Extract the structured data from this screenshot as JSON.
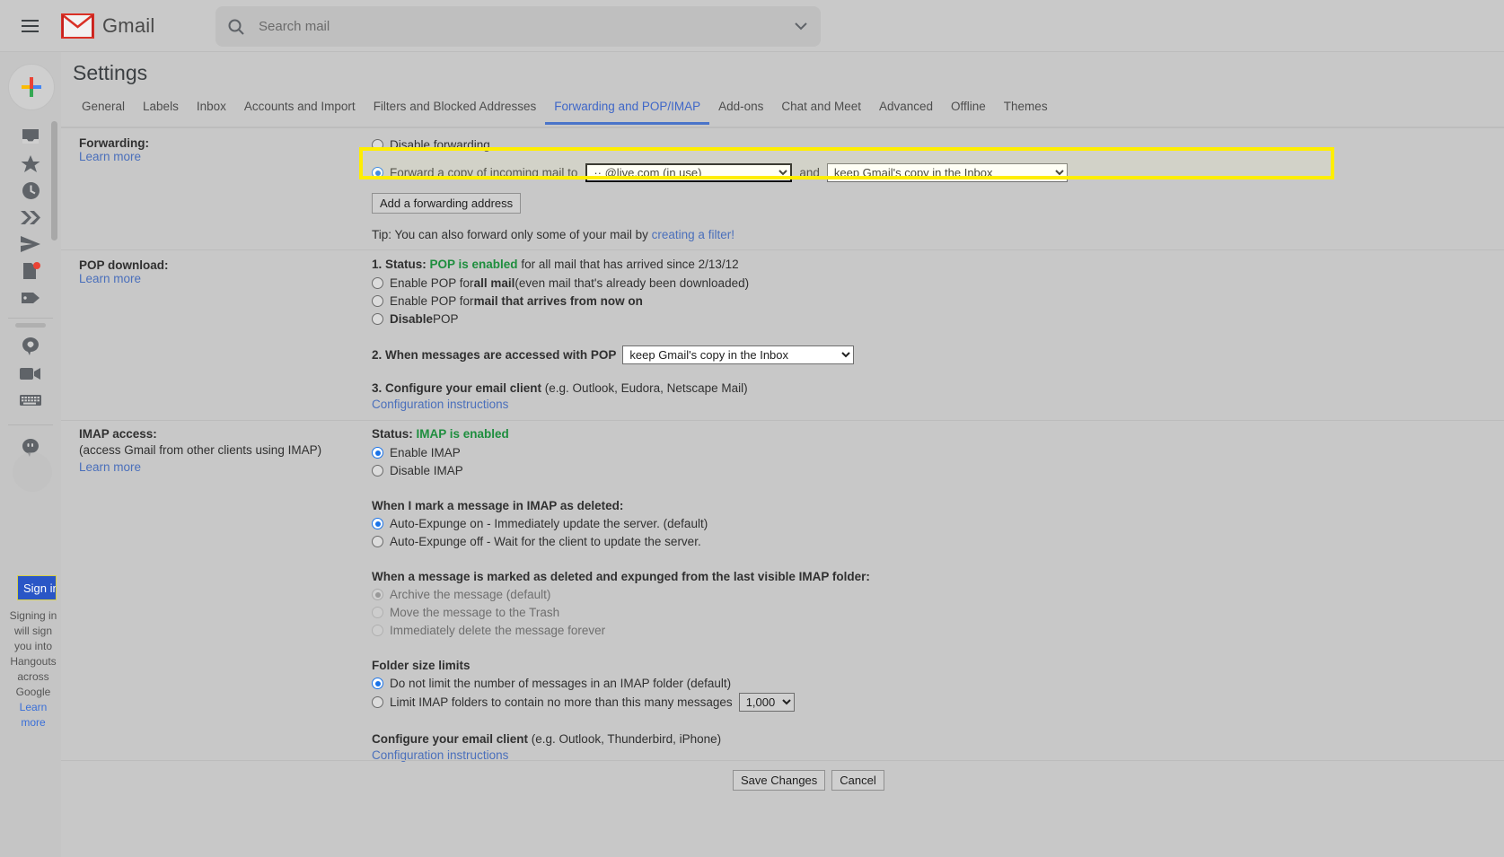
{
  "topbar": {
    "menu_icon": "hamburger-icon",
    "brand": "Gmail",
    "search_placeholder": "Search mail",
    "search_value": "",
    "search_icon": "search-icon",
    "search_options_icon": "chevron-down-icon"
  },
  "rail": {
    "compose_icon": "plus-icon",
    "items": [
      {
        "icon": "inbox-icon",
        "name": "inbox"
      },
      {
        "icon": "star-icon",
        "name": "starred"
      },
      {
        "icon": "clock-icon",
        "name": "snoozed"
      },
      {
        "icon": "double-chevron-icon",
        "name": "important"
      },
      {
        "icon": "send-icon",
        "name": "sent"
      },
      {
        "icon": "draft-icon",
        "name": "drafts"
      },
      {
        "icon": "label-icon",
        "name": "categories"
      }
    ],
    "comm_items": [
      {
        "icon": "chat-bubble-icon",
        "name": "chat"
      },
      {
        "icon": "video-camera-icon",
        "name": "meet"
      },
      {
        "icon": "keyboard-icon",
        "name": "keyboard"
      }
    ],
    "hangouts_icon": "hangouts-icon",
    "signin_label": "Sign in",
    "signin_note": "Signing in will sign you into Hangouts across Google",
    "signin_note_link": "Learn more"
  },
  "settings": {
    "title": "Settings",
    "tabs": [
      {
        "label": "General",
        "active": false
      },
      {
        "label": "Labels",
        "active": false
      },
      {
        "label": "Inbox",
        "active": false
      },
      {
        "label": "Accounts and Import",
        "active": false
      },
      {
        "label": "Filters and Blocked Addresses",
        "active": false
      },
      {
        "label": "Forwarding and POP/IMAP",
        "active": true
      },
      {
        "label": "Add-ons",
        "active": false
      },
      {
        "label": "Chat and Meet",
        "active": false
      },
      {
        "label": "Advanced",
        "active": false
      },
      {
        "label": "Offline",
        "active": false
      },
      {
        "label": "Themes",
        "active": false
      }
    ]
  },
  "forwarding": {
    "label": "Forwarding:",
    "learn_more": "Learn more",
    "disable_option": "Disable forwarding",
    "forward_option": "Forward a copy of incoming mail to",
    "address_value": "··       @live.com (in use)",
    "and_text": "and",
    "action_value": "keep Gmail's copy in the Inbox",
    "add_address_button": "Add a forwarding address",
    "tip_prefix": "Tip: You can also forward only some of your mail by ",
    "tip_link": "creating a filter!",
    "selected": "forward"
  },
  "pop": {
    "label": "POP download:",
    "learn_more": "Learn more",
    "step1_prefix": "1. Status: ",
    "step1_status": "POP is enabled",
    "step1_suffix": " for all mail that has arrived since 2/13/12",
    "options": [
      {
        "bold": "all mail",
        "pre": "Enable POP for ",
        "post": " (even mail that's already been downloaded)",
        "selected": false
      },
      {
        "bold": "mail that arrives from now on",
        "pre": "Enable POP for ",
        "post": "",
        "selected": false
      },
      {
        "bold": "Disable",
        "pre": "",
        "post": " POP",
        "selected": false
      }
    ],
    "step2_label": "2. When messages are accessed with POP",
    "step2_value": "keep Gmail's copy in the Inbox",
    "step3_bold": "3. Configure your email client",
    "step3_rest": " (e.g. Outlook, Eudora, Netscape Mail)",
    "step3_link": "Configuration instructions"
  },
  "imap": {
    "label": "IMAP access:",
    "sub": "(access Gmail from other clients using IMAP)",
    "learn_more": "Learn more",
    "status_prefix": "Status: ",
    "status_value": "IMAP is enabled",
    "enable_label": "Enable IMAP",
    "disable_label": "Disable IMAP",
    "enable_selected": true,
    "deleted_heading": "When I mark a message in IMAP as deleted:",
    "deleted_options": [
      {
        "label": "Auto-Expunge on - Immediately update the server. (default)",
        "selected": true
      },
      {
        "label": "Auto-Expunge off - Wait for the client to update the server.",
        "selected": false
      }
    ],
    "expunged_heading": "When a message is marked as deleted and expunged from the last visible IMAP folder:",
    "expunged_options": [
      {
        "label": "Archive the message (default)",
        "selected": true,
        "disabled": true
      },
      {
        "label": "Move the message to the Trash",
        "selected": false,
        "disabled": true
      },
      {
        "label": "Immediately delete the message forever",
        "selected": false,
        "disabled": true
      }
    ],
    "folder_heading": "Folder size limits",
    "folder_options": [
      {
        "label": "Do not limit the number of messages in an IMAP folder (default)",
        "selected": true
      },
      {
        "label": "Limit IMAP folders to contain no more than this many messages",
        "selected": false
      }
    ],
    "folder_limit_value": "1,000",
    "configure_bold": "Configure your email client",
    "configure_rest": " (e.g. Outlook, Thunderbird, iPhone)",
    "configure_link": "Configuration instructions"
  },
  "footer": {
    "save_label": "Save Changes",
    "cancel_label": "Cancel"
  },
  "colors": {
    "accent_blue": "#4a74c9",
    "link_blue": "#4a6fbb",
    "status_green": "#1e8e3e",
    "highlight_yellow": "#ffee00",
    "signin_blue": "#2a56c6"
  }
}
